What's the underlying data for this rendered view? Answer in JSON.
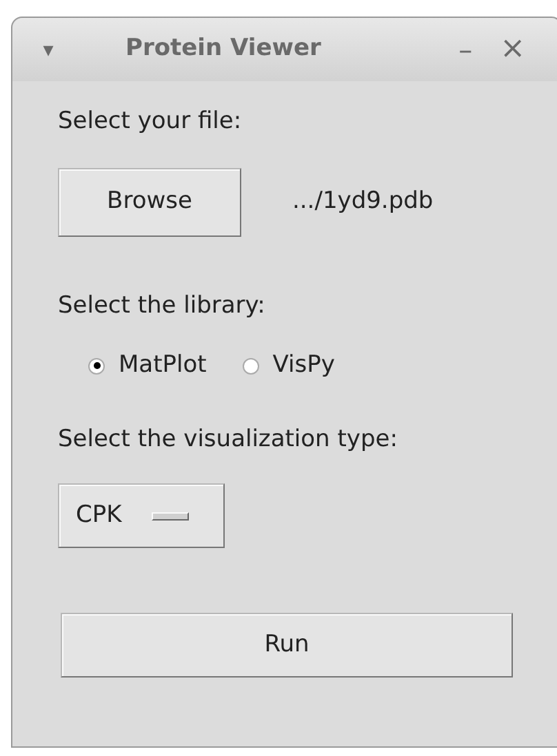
{
  "window": {
    "title": "Protein Viewer",
    "menu_glyph": "▾",
    "minimize_glyph": "–",
    "close_glyph": "×"
  },
  "file": {
    "label": "Select your file:",
    "button": "Browse",
    "path": ".../1yd9.pdb"
  },
  "library": {
    "label": "Select the library:",
    "options": [
      {
        "label": "MatPlot",
        "selected": true
      },
      {
        "label": "VisPy",
        "selected": false
      }
    ]
  },
  "visualization": {
    "label": "Select the visualization type:",
    "value": "CPK"
  },
  "run_button": "Run"
}
